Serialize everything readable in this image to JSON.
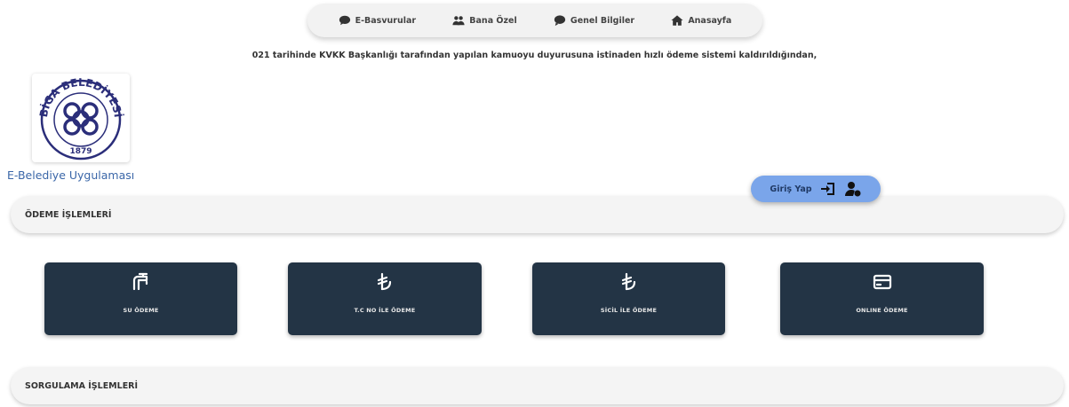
{
  "nav": {
    "items": [
      {
        "label": "E-Basvurular",
        "icon": "chat-bubble-icon"
      },
      {
        "label": "Bana Özel",
        "icon": "users-icon"
      },
      {
        "label": "Genel Bilgiler",
        "icon": "comment-icon"
      },
      {
        "label": "Anasayfa",
        "icon": "home-icon"
      }
    ]
  },
  "notice": "021 tarihinde KVKK Başkanlığı tarafından yapılan kamuoyu duyurusuna istinaden hızlı ödeme sistemi kaldırıldığından,",
  "logo": {
    "text": "BİGA BELEDİYESİ",
    "year": "1879",
    "color": "#2b2e7a"
  },
  "app": {
    "title": "E-Belediye Uygulaması"
  },
  "login": {
    "label": "Giriş Yap",
    "color": "#7aa5ea"
  },
  "sections": {
    "payment": {
      "title": "ÖDEME İŞLEMLERİ"
    },
    "query": {
      "title": "SORGULAMA İŞLEMLERİ"
    }
  },
  "tiles": [
    {
      "label": "SU ÖDEME",
      "icon": "water-tap-icon"
    },
    {
      "label": "T.C NO İLE ÖDEME",
      "icon": "lira-icon"
    },
    {
      "label": "SİCİL İLE ÖDEME",
      "icon": "lira-icon"
    },
    {
      "label": "ONLINE ÖDEME",
      "icon": "credit-card-icon"
    }
  ],
  "colors": {
    "tile_bg": "#233445",
    "title_blue": "#3a66a8"
  }
}
